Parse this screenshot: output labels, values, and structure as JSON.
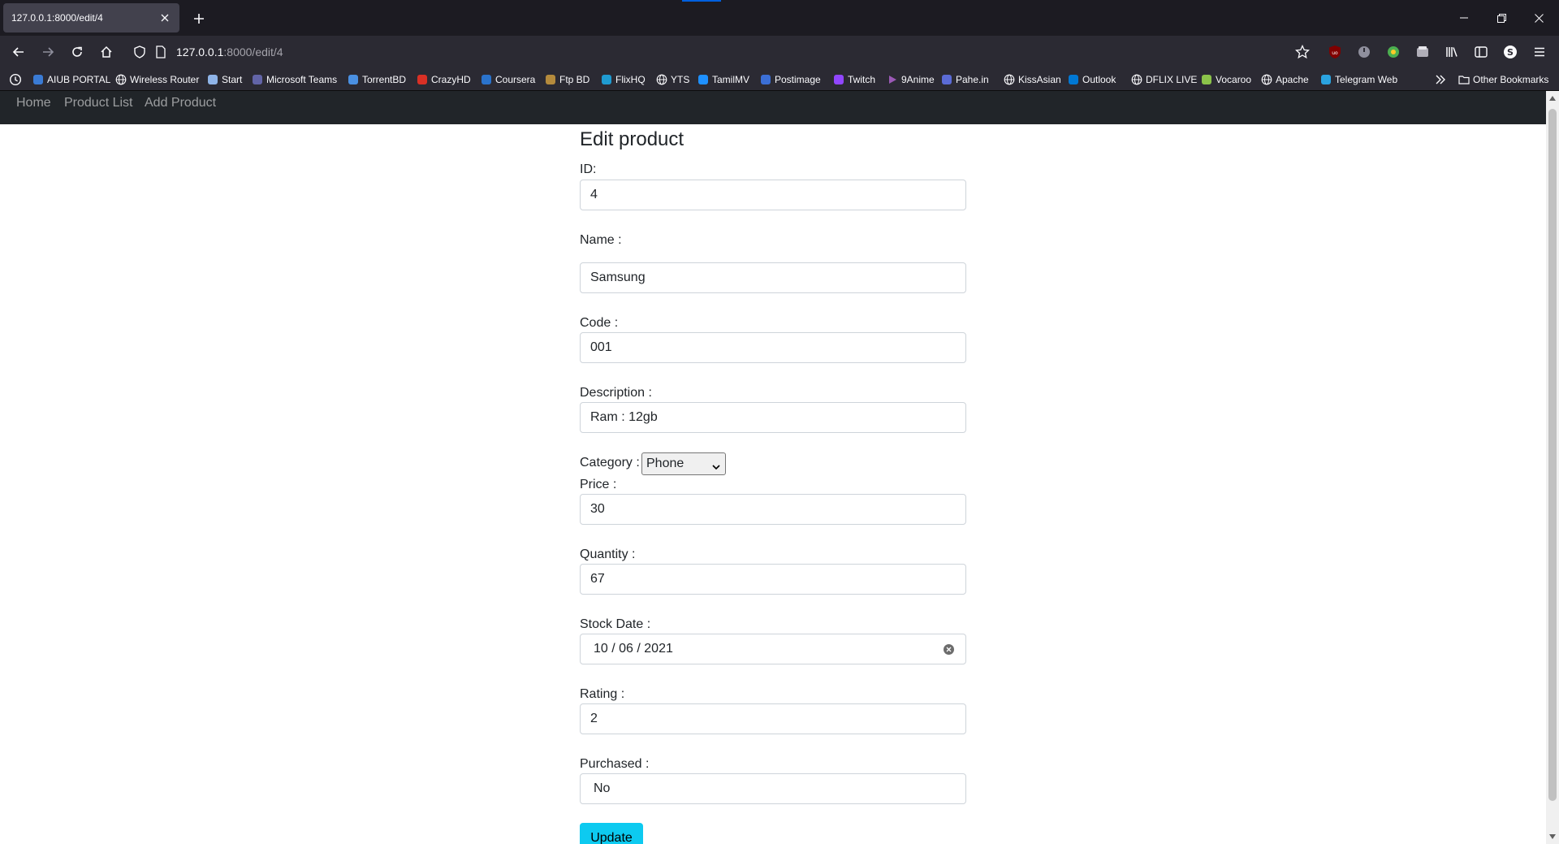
{
  "browser": {
    "tab_title": "127.0.0.1:8000/edit/4",
    "url_host": "127.0.0.1",
    "url_rest": ":8000/edit/4",
    "profile_initial": "S",
    "ublock_label": "uo",
    "bookmarks": [
      {
        "label": "AIUB PORTAL",
        "icon": "shield-logo-icon",
        "color": "#3a7bd5"
      },
      {
        "label": "Wireless Router",
        "icon": "globe-icon",
        "color": "#fbfbfe"
      },
      {
        "label": "Start",
        "icon": "shield-logo-icon",
        "color": "#8fb4e8"
      },
      {
        "label": "Microsoft Teams",
        "icon": "teams-icon",
        "color": "#6264a7"
      },
      {
        "label": "TorrentBD",
        "icon": "torrentbd-icon",
        "color": "#4a90e2"
      },
      {
        "label": "CrazyHD",
        "icon": "crazyhd-icon",
        "color": "#d93025"
      },
      {
        "label": "Coursera",
        "icon": "coursera-icon",
        "color": "#2a73cc"
      },
      {
        "label": "Ftp BD",
        "icon": "ftp-icon",
        "color": "#b48a3c"
      },
      {
        "label": "FlixHQ",
        "icon": "play-circle-icon",
        "color": "#1f9bd1"
      },
      {
        "label": "YTS",
        "icon": "globe-icon",
        "color": "#fbfbfe"
      },
      {
        "label": "TamilMV",
        "icon": "play-circle-icon",
        "color": "#1e90ff"
      },
      {
        "label": "Postimage",
        "icon": "postimage-icon",
        "color": "#3b6fd6"
      },
      {
        "label": "Twitch",
        "icon": "twitch-icon",
        "color": "#9146ff"
      },
      {
        "label": "9Anime",
        "icon": "play-triangle-icon",
        "color": "#9b59b6"
      },
      {
        "label": "Pahe.in",
        "icon": "pahe-icon",
        "color": "#5b6bd6"
      },
      {
        "label": "KissAsian",
        "icon": "globe-icon",
        "color": "#fbfbfe"
      },
      {
        "label": "Outlook",
        "icon": "outlook-icon",
        "color": "#0078d4"
      },
      {
        "label": "DFLIX LIVE",
        "icon": "globe-icon",
        "color": "#fbfbfe"
      },
      {
        "label": "Vocaroo",
        "icon": "vocaroo-icon",
        "color": "#8bc34a"
      },
      {
        "label": "Apache",
        "icon": "globe-icon",
        "color": "#fbfbfe"
      },
      {
        "label": "Telegram Web",
        "icon": "telegram-icon",
        "color": "#2aa3e0"
      }
    ],
    "other_bookmarks": "Other Bookmarks"
  },
  "app_nav": {
    "home": "Home",
    "product_list": "Product List",
    "add_product": "Add Product"
  },
  "form": {
    "title": "Edit product",
    "id_label": "ID:",
    "id_value": "4",
    "name_label": "Name :",
    "name_value": "Samsung",
    "code_label": "Code :",
    "code_value": "001",
    "description_label": "Description :",
    "description_value": "Ram : 12gb",
    "category_label": "Category :",
    "category_value": "Phone",
    "price_label": "Price :",
    "price_value": "30",
    "quantity_label": "Quantity :",
    "quantity_value": "67",
    "stock_date_label": "Stock Date :",
    "stock_date_value": "10 / 06 / 2021",
    "rating_label": "Rating :",
    "rating_value": "2",
    "purchased_label": "Purchased :",
    "purchased_value": "No",
    "update_button": "Update"
  },
  "colors": {
    "chrome_dark": "#1c1b22",
    "toolbar": "#2b2a33",
    "app_nav": "#212529",
    "button_info": "#0dcaf0"
  }
}
